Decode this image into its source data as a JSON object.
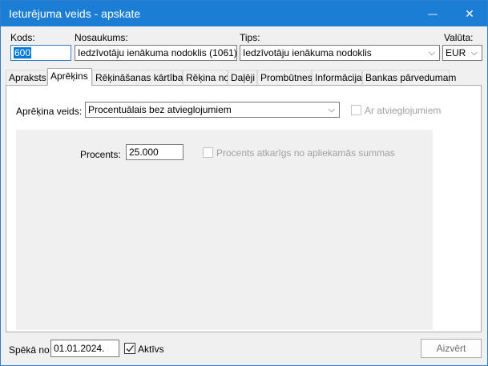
{
  "window": {
    "title": "Ieturējuma veids - apskate",
    "minimize_glyph": "—",
    "close_glyph": "✕"
  },
  "header": {
    "code_label": "Kods:",
    "code_value": "600",
    "name_label": "Nosaukums:",
    "name_value": "Iedzīvotāju ienākuma nodoklis (1061)",
    "type_label": "Tips:",
    "type_value": "Iedzīvotāju ienākuma nodoklis",
    "currency_label": "Valūta:",
    "currency_value": "EUR"
  },
  "tabs": [
    {
      "label": "Apraksts"
    },
    {
      "label": "Aprēķins"
    },
    {
      "label": "Rēķināšanas kārtība"
    },
    {
      "label": "Rēķina no"
    },
    {
      "label": "Daļēji"
    },
    {
      "label": "Prombūtnes"
    },
    {
      "label": "Informācija"
    },
    {
      "label": "Bankas pārvedumam"
    }
  ],
  "active_tab": "Aprēķins",
  "calc": {
    "method_label": "Aprēķina veids:",
    "method_value": "Procentuālais bez atvieglojumiem",
    "with_relief_label": "Ar atvieglojumiem",
    "percent_label": "Procents:",
    "percent_value": "25.000",
    "percent_dependent_label": "Procents atkarīgs no apliekamās summas"
  },
  "footer": {
    "valid_from_label": "Spēkā no:",
    "valid_from_value": "01.01.2024.",
    "active_label": "Aktīvs",
    "active_checked": true,
    "close_button_label": "Aizvērt"
  },
  "icons": {
    "dropdown": "chevron-down-icon",
    "check": "check-icon"
  },
  "colors": {
    "titlebar": "#1c7dd5",
    "selection": "#0078d7"
  }
}
